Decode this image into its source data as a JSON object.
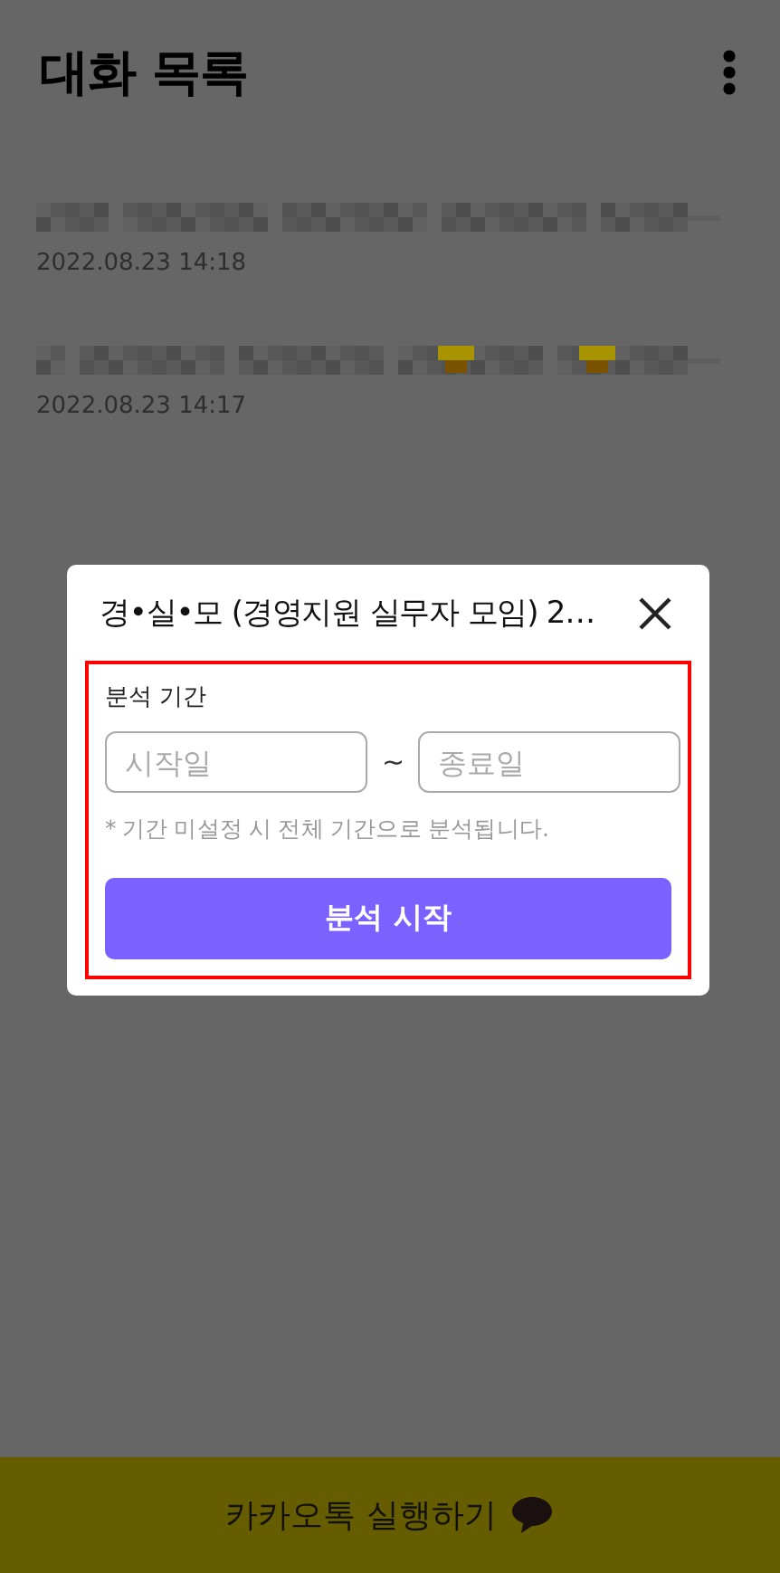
{
  "header": {
    "title": "대화 목록"
  },
  "chats": [
    {
      "time": "2022.08.23 14:18"
    },
    {
      "time": "2022.08.23 14:17"
    }
  ],
  "dialog": {
    "title": "경•실•모 (경영지원 실무자 모임) 2…",
    "highlighted": true,
    "section_label": "분석 기간",
    "start": {
      "placeholder": "시작일"
    },
    "separator": "~",
    "end": {
      "placeholder": "종료일"
    },
    "note": "* 기간 미설정 시 전체 기간으로 분석됩니다.",
    "button": "분석 시작"
  },
  "bottom_bar": {
    "label": "카카오톡 실행하기"
  }
}
